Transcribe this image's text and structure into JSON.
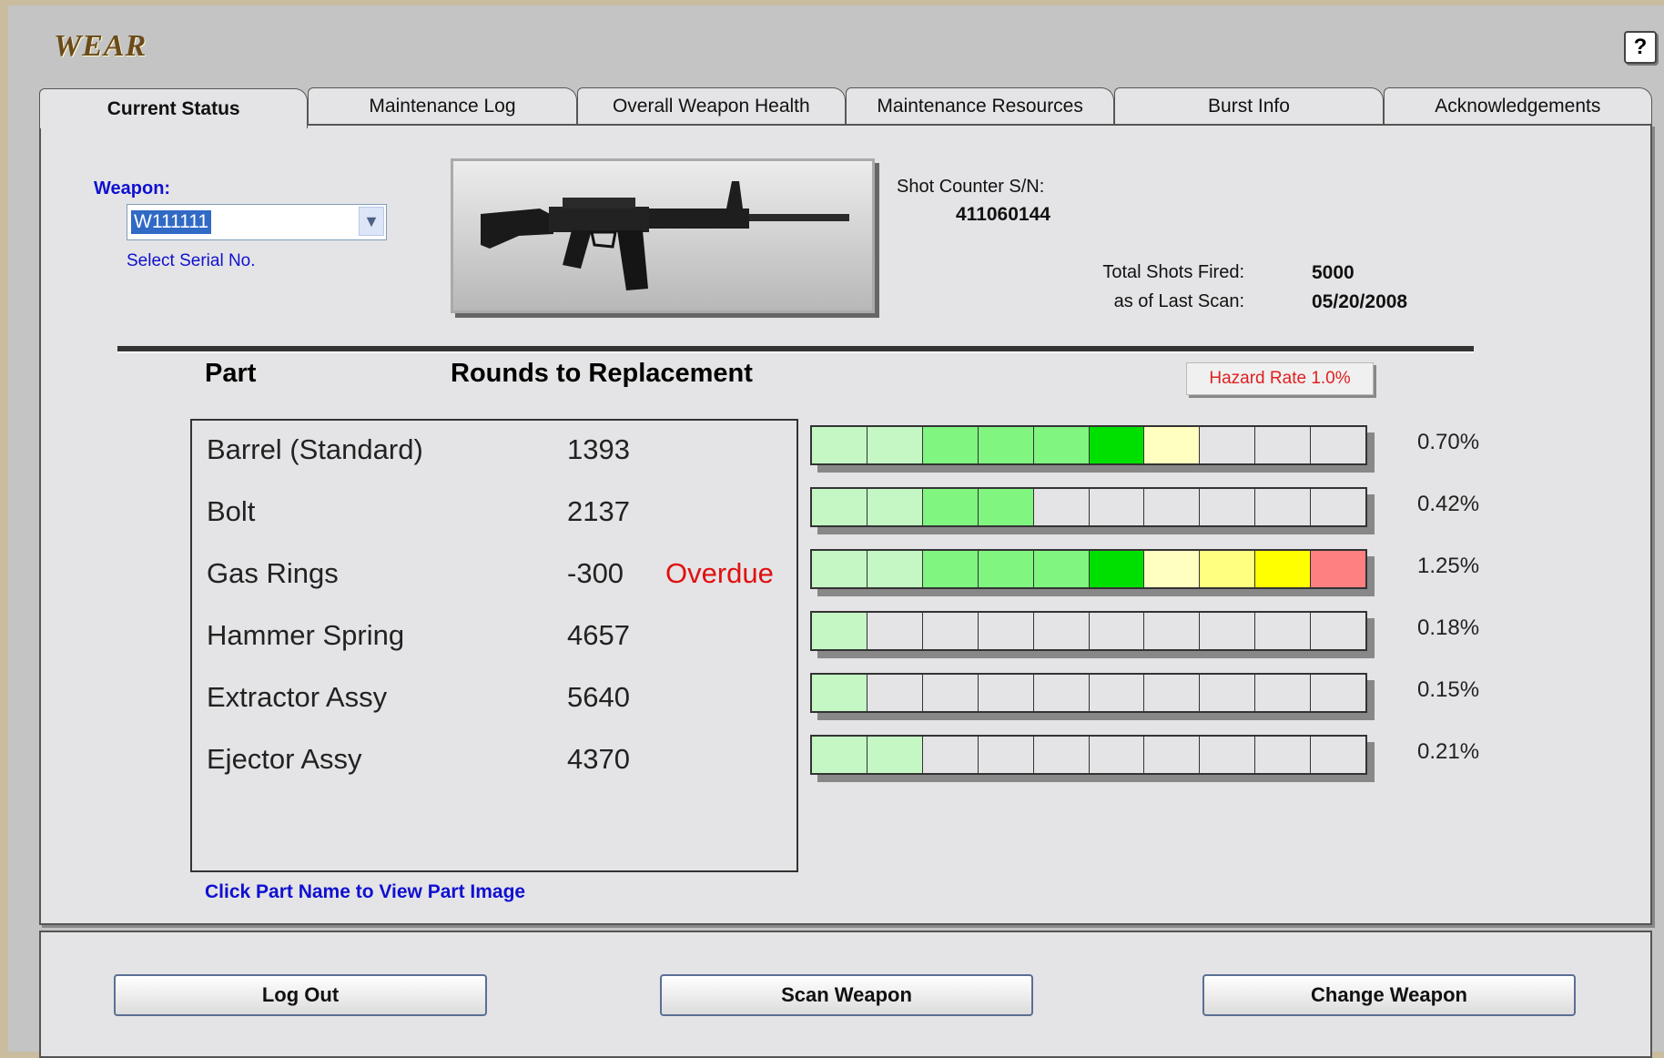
{
  "app": {
    "title": "WEAR",
    "help_label": "?"
  },
  "tabs": [
    {
      "label": "Current Status",
      "active": true
    },
    {
      "label": "Maintenance Log"
    },
    {
      "label": "Overall Weapon Health"
    },
    {
      "label": "Maintenance Resources"
    },
    {
      "label": "Burst Info"
    },
    {
      "label": "Acknowledgements"
    }
  ],
  "weapon": {
    "label": "Weapon:",
    "selected": "W111111",
    "hint": "Select Serial No.",
    "image": "rifle-image"
  },
  "counter": {
    "sn_label": "Shot Counter S/N:",
    "sn_value": "411060144",
    "total_label": "Total Shots Fired:",
    "total_value": "5000",
    "scan_label": "as of Last Scan:",
    "scan_value": "05/20/2008"
  },
  "table": {
    "part_header": "Part",
    "rounds_header": "Rounds to Replacement",
    "hazard_rate": "Hazard Rate 1.0%",
    "hint": "Click Part Name to View Part Image",
    "parts": [
      {
        "name": "Barrel (Standard)",
        "rounds": "1393",
        "status": "",
        "pct": "0.70%",
        "filled": 7
      },
      {
        "name": "Bolt",
        "rounds": "2137",
        "status": "",
        "pct": "0.42%",
        "filled": 4
      },
      {
        "name": "Gas Rings",
        "rounds": "-300",
        "status": "Overdue",
        "pct": "1.25%",
        "filled": 10
      },
      {
        "name": "Hammer Spring",
        "rounds": "4657",
        "status": "",
        "pct": "0.18%",
        "filled": 1
      },
      {
        "name": "Extractor Assy",
        "rounds": "5640",
        "status": "",
        "pct": "0.15%",
        "filled": 1
      },
      {
        "name": "Ejector Assy",
        "rounds": "4370",
        "status": "",
        "pct": "0.21%",
        "filled": 2
      }
    ],
    "segment_colors": [
      "#c4f7c4",
      "#c4f7c4",
      "#80f580",
      "#80f580",
      "#80f580",
      "#00e000",
      "#ffffc0",
      "#ffff80",
      "#ffff00",
      "#ff8080"
    ],
    "empty_color": "#e4e4e6"
  },
  "footer": {
    "logout_label": "Log Out",
    "scan_label": "Scan Weapon",
    "change_label": "Change Weapon"
  }
}
